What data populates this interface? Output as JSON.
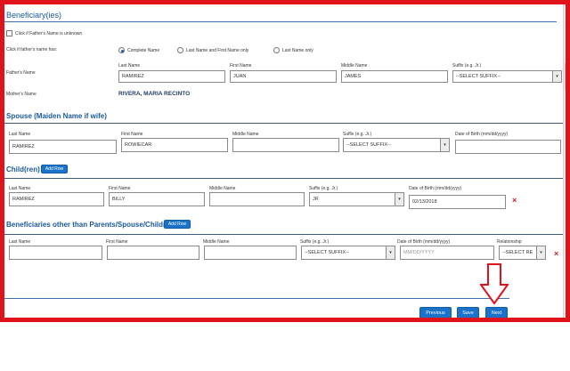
{
  "section_title": "Beneficiary(ies)",
  "father_unknown_label": "Click if Father's Name is unknown",
  "father_name_prompt": "Click if father's name has:",
  "radio_options": [
    "Complete Name",
    "Last Name and First Name only",
    "Last Name only"
  ],
  "father": {
    "row_label": "Father's Name",
    "last_name_label": "Last Name",
    "first_name_label": "First Name",
    "middle_name_label": "Middle Name",
    "suffix_label": "Suffix (e.g. Jr.)",
    "last_name": "RAMIREZ",
    "first_name": "JUAN",
    "middle_name": "JAMES",
    "suffix": "--SELECT SUFFIX--"
  },
  "mother": {
    "row_label": "Mother's Name",
    "value": "RIVERA, MARIA RECINTO"
  },
  "spouse": {
    "title": "Spouse (Maiden Name if wife)",
    "last_name_label": "Last Name",
    "first_name_label": "First Name",
    "middle_name_label": "Middle Name",
    "suffix_label": "Suffix (e.g. Jr.)",
    "dob_label": "Date of Birth (mm/dd/yyyy)",
    "last_name": "RAMIREZ",
    "first_name": "ROWIECAR",
    "middle_name": "",
    "suffix": "--SELECT SUFFIX--",
    "dob": ""
  },
  "children": {
    "title": "Child(ren)",
    "add_label": "Add Row",
    "last_name_label": "Last Name",
    "first_name_label": "First Name",
    "middle_name_label": "Middle Name",
    "suffix_label": "Suffix (e.g. Jr.)",
    "dob_label": "Date of Birth (mm/dd/yyyy)",
    "row": {
      "last_name": "RAMIREZ",
      "first_name": "BILLY",
      "middle_name": "",
      "suffix": "JR",
      "dob": "02/13/2018"
    }
  },
  "others": {
    "title": "Beneficiaries other than Parents/Spouse/Children",
    "add_label": "Add Row",
    "last_name_label": "Last Name",
    "first_name_label": "First Name",
    "middle_name_label": "Middle Name",
    "suffix_label": "Suffix (e.g. Jr.)",
    "dob_label": "Date of Birth (mm/dd/yyyy)",
    "relationship_label": "Relationship",
    "row": {
      "last_name": "",
      "first_name": "",
      "middle_name": "",
      "suffix": "--SELECT SUFFIX--",
      "dob_placeholder": "MM/DD/YYYY",
      "relationship": "--SELECT RE"
    }
  },
  "nav": {
    "previous": "Previous",
    "save": "Save",
    "next": "Next"
  },
  "icons": {
    "delete": "×",
    "dropdown": "▾",
    "annotation_arrow": "down-arrow-outline"
  },
  "colors": {
    "frame": "#e0131a",
    "accent": "#1a5aa0",
    "button": "#1a73c8",
    "delete": "#d01f1f"
  }
}
